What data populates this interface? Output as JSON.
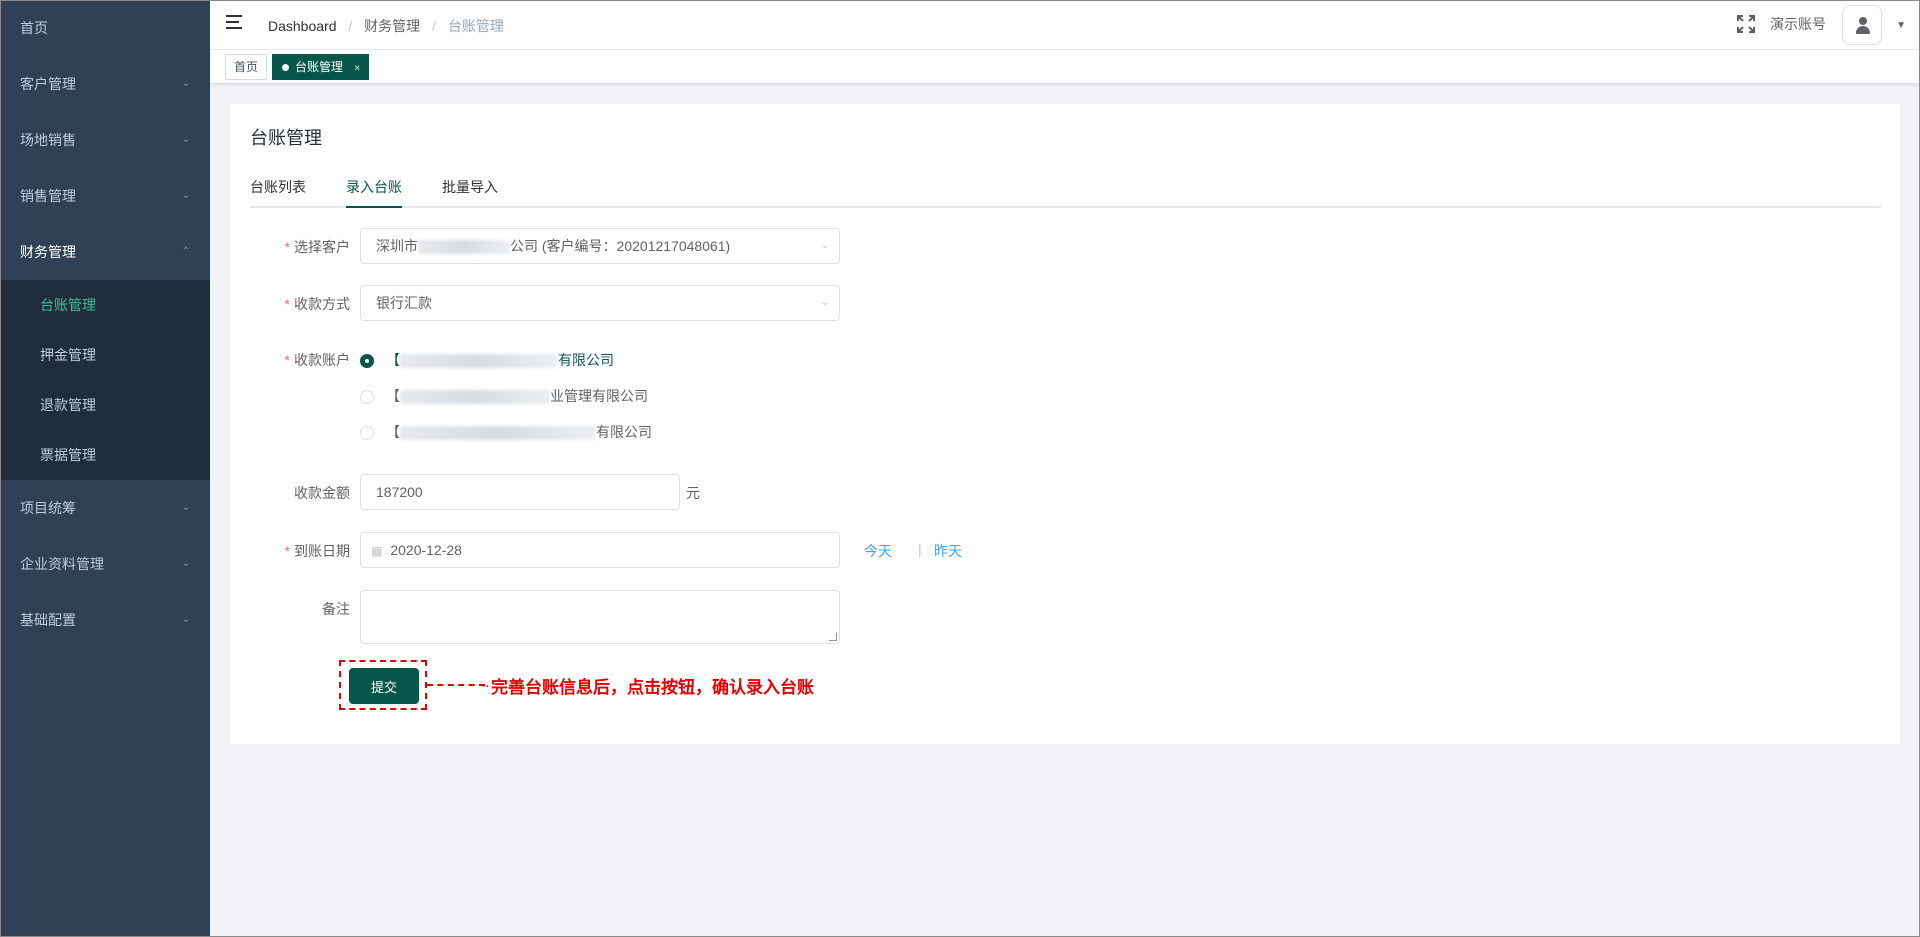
{
  "sidebar": {
    "items": [
      {
        "label": "首页"
      },
      {
        "label": "客户管理",
        "arrow": "chevron-down-icon"
      },
      {
        "label": "场地销售",
        "arrow": "chevron-down-icon"
      },
      {
        "label": "销售管理",
        "arrow": "chevron-down-icon"
      },
      {
        "label": "财务管理",
        "arrow": "chevron-up-icon"
      },
      {
        "label": "项目统筹",
        "arrow": "chevron-down-icon"
      },
      {
        "label": "企业资料管理",
        "arrow": "chevron-down-icon"
      },
      {
        "label": "基础配置",
        "arrow": "chevron-down-icon"
      }
    ],
    "finance_submenu": [
      {
        "label": "台账管理",
        "active": true
      },
      {
        "label": "押金管理"
      },
      {
        "label": "退款管理"
      },
      {
        "label": "票据管理"
      }
    ]
  },
  "navbar": {
    "breadcrumb": [
      "Dashboard",
      "财务管理",
      "台账管理"
    ],
    "separator": "/",
    "username": "演示账号",
    "icons": [
      "hamburger-icon",
      "fullscreen-icon",
      "avatar-icon",
      "caret-down-icon"
    ]
  },
  "tags": [
    {
      "label": "首页"
    },
    {
      "label": "台账管理",
      "active": true,
      "close": "×"
    }
  ],
  "page": {
    "title": "台账管理",
    "tabs": [
      "台账列表",
      "录入台账",
      "批量导入"
    ],
    "active_tab": "录入台账"
  },
  "form": {
    "customer": {
      "label": "选择客户",
      "prefix": "深圳市",
      "suffix": "公司 (客户编号：20201217048061)"
    },
    "method": {
      "label": "收款方式",
      "value": "银行汇款"
    },
    "account": {
      "label": "收款账户",
      "options": [
        {
          "prefix": "【",
          "suffix": "有限公司",
          "checked": true
        },
        {
          "prefix": "【",
          "suffix": "业管理有限公司",
          "checked": false
        },
        {
          "prefix": "【",
          "suffix": "有限公司",
          "checked": false
        }
      ]
    },
    "amount": {
      "label": "收款金额",
      "value": "187200",
      "unit": "元"
    },
    "date": {
      "label": "到账日期",
      "value": "2020-12-28",
      "today": "今天",
      "sep": "|",
      "yesterday": "昨天"
    },
    "remark": {
      "label": "备注",
      "value": ""
    },
    "submit": "提交"
  },
  "annotation": {
    "arrow": "→",
    "text": "完善台账信息后，点击按钮，确认录入台账"
  },
  "colors": {
    "sidebar_bg": "#304156",
    "submenu_bg": "#1f2d3d",
    "active_menu": "#3fbfa0",
    "primary": "#06564a",
    "link": "#409eff",
    "required": "#f56c6c",
    "annotation": "#e10000"
  }
}
